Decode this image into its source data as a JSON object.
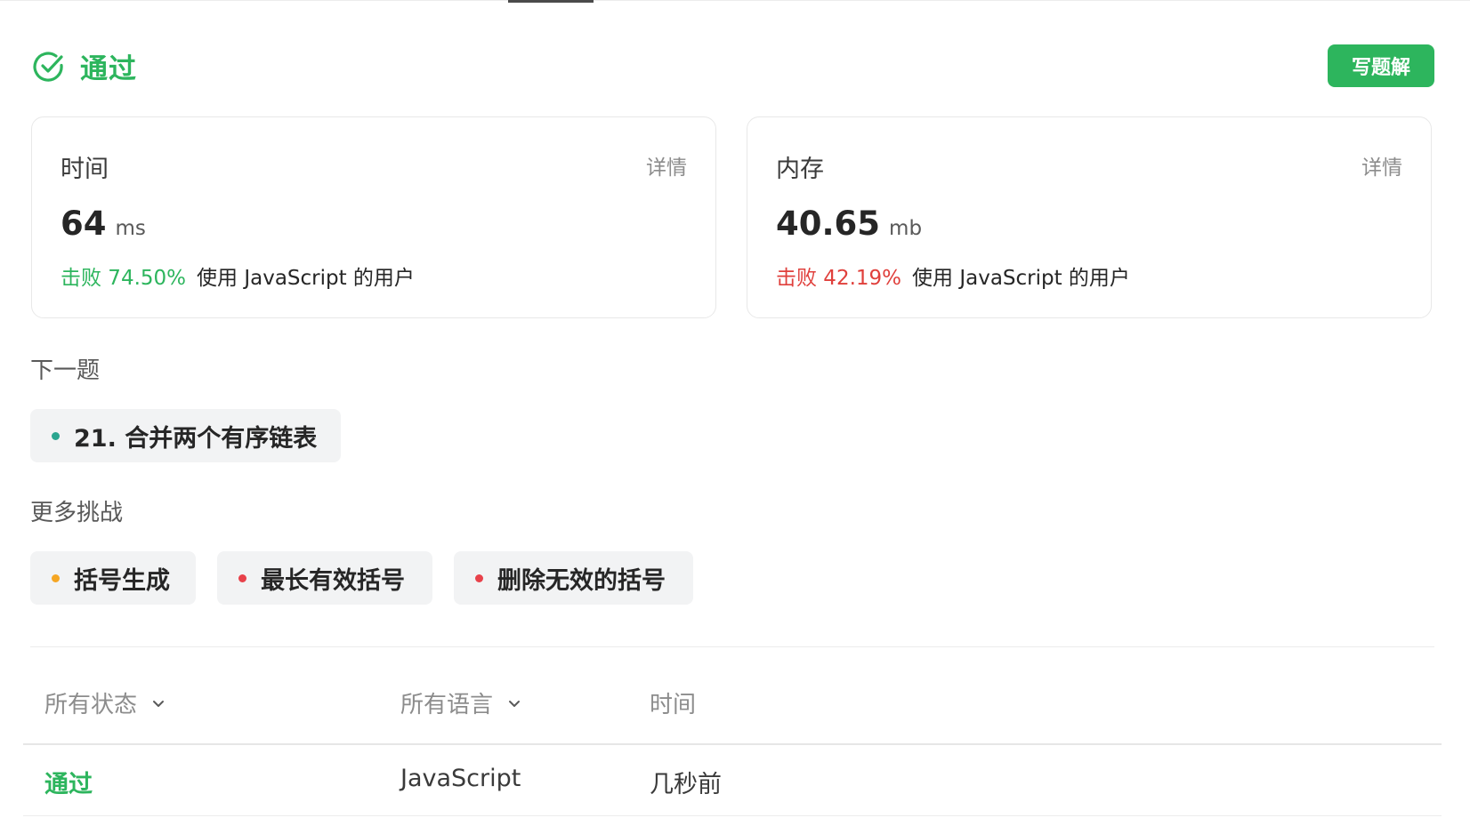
{
  "result": {
    "status": "通过",
    "status_color": "#2db55d",
    "write_solution_label": "写题解"
  },
  "time_card": {
    "title": "时间",
    "detail_label": "详情",
    "value": "64",
    "unit": "ms",
    "beat_text": "击败 74.50%",
    "beat_color": "#2db55d",
    "beat_desc": "使用 JavaScript 的用户"
  },
  "memory_card": {
    "title": "内存",
    "detail_label": "详情",
    "value": "40.65",
    "unit": "mb",
    "beat_text": "击败 42.19%",
    "beat_color": "#e0403c",
    "beat_desc": "使用 JavaScript 的用户"
  },
  "next_problem": {
    "label": "下一题",
    "item": {
      "title": "21. 合并两个有序链表",
      "difficulty_color": "#2aa58f"
    }
  },
  "more_challenges": {
    "label": "更多挑战",
    "items": [
      {
        "title": "括号生成",
        "difficulty_color": "#f5a623"
      },
      {
        "title": "最长有效括号",
        "difficulty_color": "#e8414a"
      },
      {
        "title": "删除无效的括号",
        "difficulty_color": "#e8414a"
      }
    ]
  },
  "submissions": {
    "filters": {
      "status_label": "所有状态",
      "language_label": "所有语言",
      "time_label": "时间"
    },
    "rows": [
      {
        "status": "通过",
        "language": "JavaScript",
        "time": "几秒前"
      }
    ]
  },
  "icons": {
    "status_icon": "check-circle-icon",
    "filter_chevron": "chevron-down-icon"
  }
}
